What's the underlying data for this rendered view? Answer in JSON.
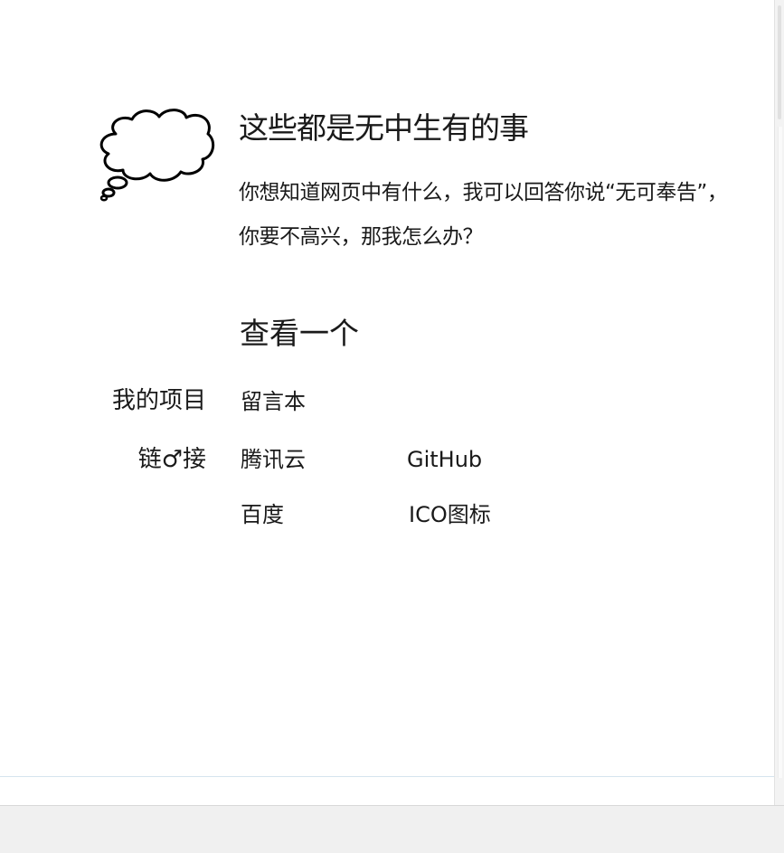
{
  "intro": {
    "title": "这些都是无中生有的事",
    "text": "你想知道网页中有什么，我可以回答你说“无可奉告”，你要不高兴，那我怎么办？"
  },
  "section": {
    "heading": "查看一个"
  },
  "projects": {
    "label": "我的项目",
    "items": [
      {
        "label": "留言本"
      }
    ]
  },
  "links": {
    "label": "链♂接",
    "items": [
      {
        "label": "腾讯云"
      },
      {
        "label": "GitHub"
      },
      {
        "label": "百度"
      },
      {
        "label": "ICO图标"
      }
    ]
  },
  "icons": {
    "intro_icon": "thought-bubble-icon"
  }
}
